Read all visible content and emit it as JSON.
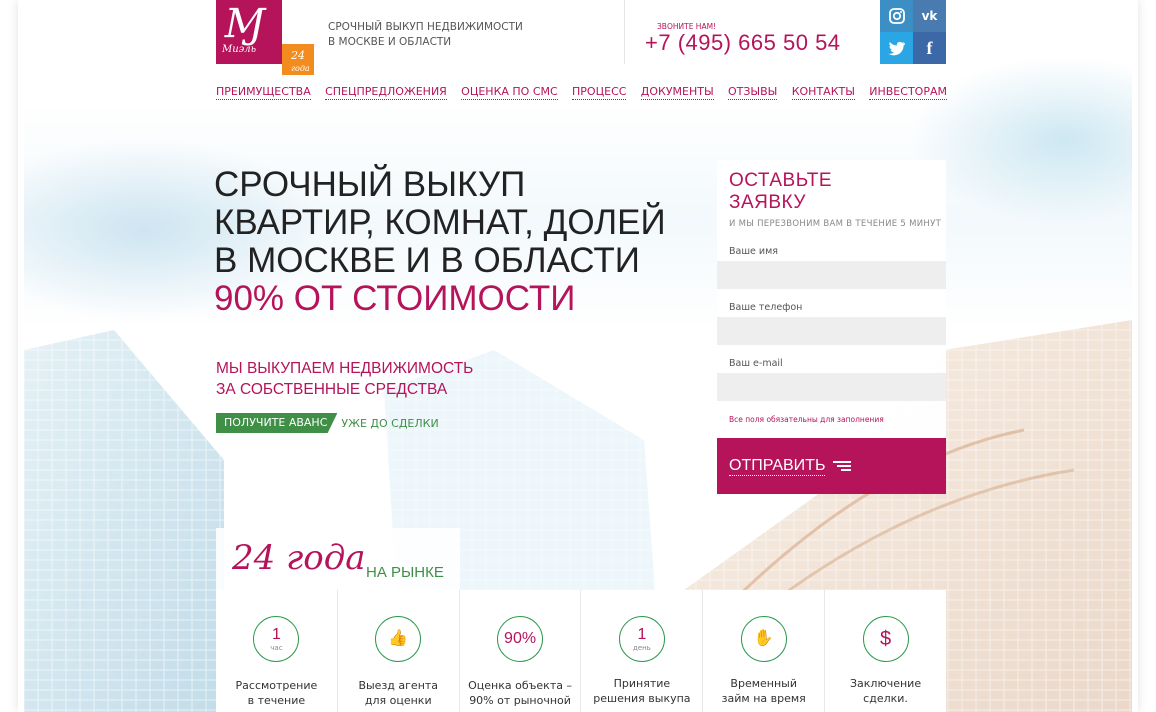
{
  "header": {
    "logo_mark": "Ɱ",
    "logo_word": "Миэль",
    "badge_line1": "24",
    "badge_line2": "года",
    "tagline_line1": "СРОЧНЫЙ ВЫКУП НЕДВИЖИМОСТИ",
    "tagline_line2": "В МОСКВЕ И ОБЛАСТИ",
    "call_label": "ЗВОНИТЕ НАМ!",
    "phone": "+7 (495) 665 50 54"
  },
  "social": [
    {
      "icon": "instagram-icon",
      "glyph": "◎"
    },
    {
      "icon": "vk-icon",
      "glyph": "vk"
    },
    {
      "icon": "twitter-icon",
      "glyph": "🐦"
    },
    {
      "icon": "facebook-icon",
      "glyph": "f"
    }
  ],
  "nav": [
    "ПРЕИМУЩЕСТВА",
    "СПЕЦПРЕДЛОЖЕНИЯ",
    "ОЦЕНКА ПО СМС",
    "ПРОЦЕСС",
    "ДОКУМЕНТЫ",
    "ОТЗЫВЫ",
    "КОНТАКТЫ",
    "ИНВЕСТОРАМ"
  ],
  "hero": {
    "line1": "СРОЧНЫЙ ВЫКУП",
    "line2": "КВАРТИР, КОМНАТ, ДОЛЕЙ",
    "line3": "В МОСКВЕ И В ОБЛАСТИ",
    "line4": "90% ОТ СТОИМОСТИ",
    "sub1": "МЫ ВЫКУПАЕМ НЕДВИЖИМОСТЬ",
    "sub2": "ЗА СОБСТВЕННЫЕ СРЕДСТВА",
    "advance_button": "ПОЛУЧИТЕ АВАНС",
    "advance_text": "УЖЕ ДО СДЕЛКИ"
  },
  "form": {
    "title1": "ОСТАВЬТЕ",
    "title2": "ЗАЯВКУ",
    "subtitle": "И МЫ ПЕРЕЗВОНИМ ВАМ В ТЕЧЕНИЕ 5 МИНУТ",
    "name_label": "Ваше имя",
    "name_value": "",
    "phone_label": "Ваше телефон",
    "phone_value": "",
    "email_label": "Ваш e-mail",
    "email_value": "",
    "note": "Все поля обязательны для заполнения",
    "submit": "ОТПРАВИТЬ"
  },
  "years": {
    "number": "24 года",
    "text": "НА РЫНКЕ"
  },
  "features": [
    {
      "big": "1",
      "small": "час",
      "text1": "Рассмотрение",
      "text2": "в течение"
    },
    {
      "big": "👍",
      "small": "",
      "text1": "Выезд агента",
      "text2": "для оценки"
    },
    {
      "big": "90%",
      "small": "",
      "text1": "Оценка объекта –",
      "text2": "90% от рыночной"
    },
    {
      "big": "1",
      "small": "день",
      "text1": "Принятие",
      "text2": "решения выкупа"
    },
    {
      "big": "✋",
      "small": "",
      "text1": "Временный",
      "text2": "займ на время"
    },
    {
      "big": "$",
      "small": "",
      "text1": "Заключение",
      "text2": "сделки."
    }
  ]
}
